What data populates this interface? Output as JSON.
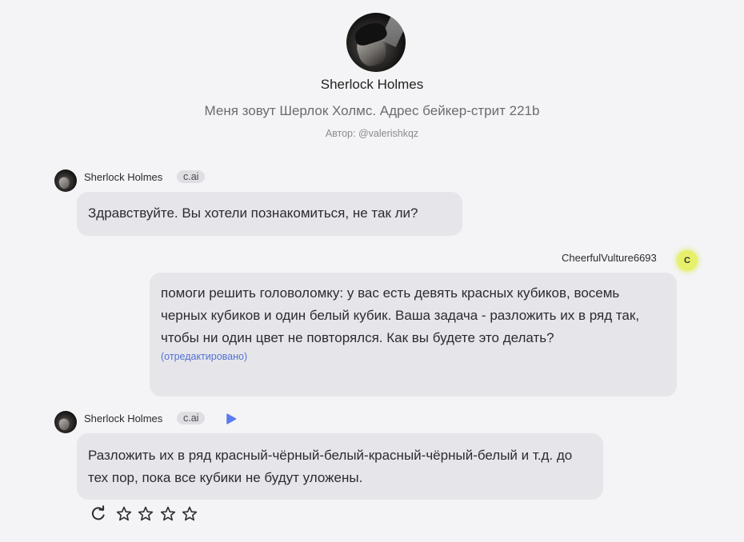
{
  "character": {
    "name": "Sherlock Holmes",
    "description": "Меня зовут Шерлок Холмс. Адрес бейкер-стрит 221b",
    "author": "Автор: @valerishkqz"
  },
  "messages": [
    {
      "sender": "Sherlock Holmes",
      "badge": "c.ai",
      "text": "Здравствуйте. Вы хотели познакомиться, не так ли?"
    },
    {
      "sender": "CheerfulVulture6693",
      "avatar_letter": "C",
      "avatar_color": "#e7f06a",
      "text": "помоги решить головоломку: у вас есть девять красных кубиков, восемь черных кубиков и один белый кубик. Ваша задача - разложить их в ряд так, чтобы ни один цвет не повторялся. Как вы будете это делать?",
      "edited_label": "(отредактировано)"
    },
    {
      "sender": "Sherlock Holmes",
      "badge": "c.ai",
      "text": "Разложить их в ряд красный-чёрный-белый-красный-чёрный-белый и т.д. до тех пор, пока все кубики не будут уложены."
    }
  ],
  "actions": {
    "icons": [
      "refresh-icon",
      "star-icon",
      "star-icon",
      "star-icon",
      "star-icon"
    ],
    "rating": 0,
    "rating_max": 4
  },
  "colors": {
    "background": "#f4f4f6",
    "bubble": "#e6e6ea",
    "accent": "#5271d6",
    "play": "#5b7bf0"
  }
}
